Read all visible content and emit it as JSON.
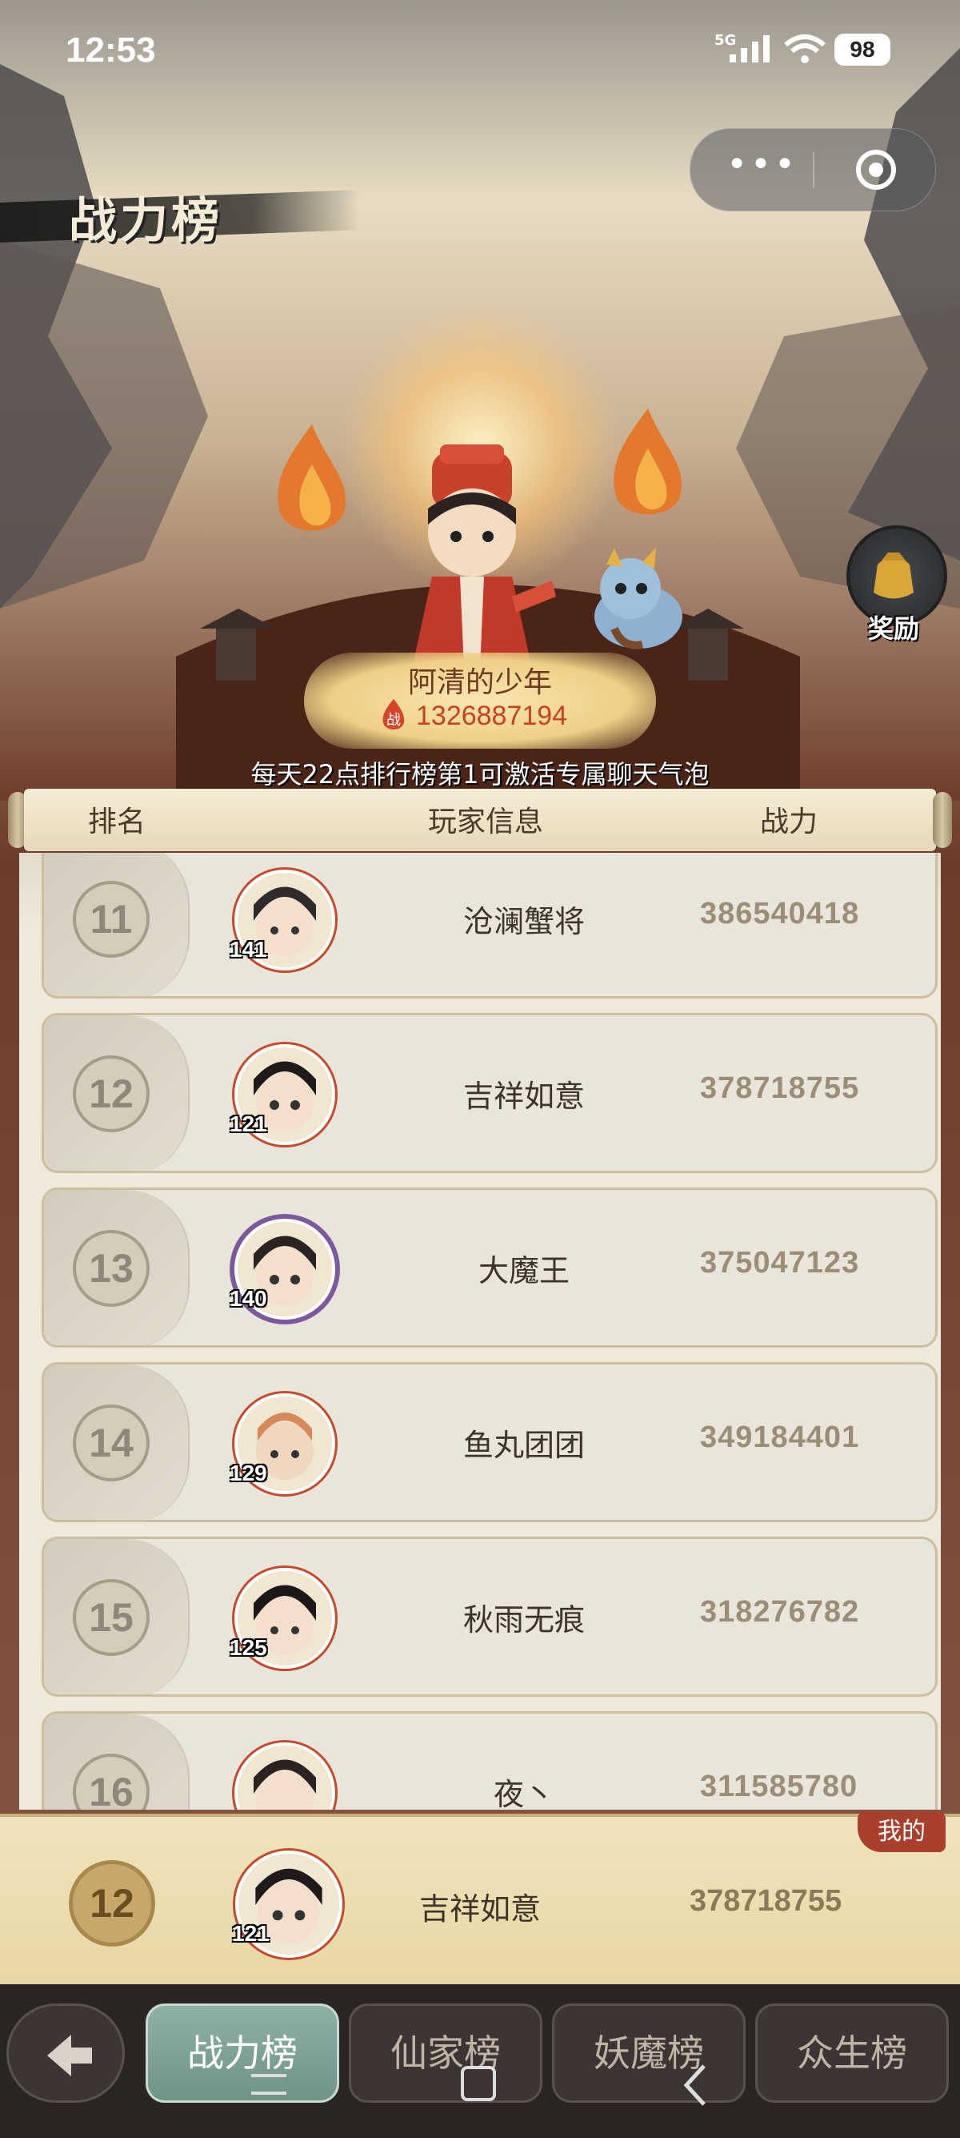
{
  "status_bar": {
    "time": "12:53",
    "network": "5G",
    "battery": "98"
  },
  "header": {
    "title": "战力榜",
    "menu_dots": "•••"
  },
  "reward": {
    "label": "奖励"
  },
  "top_player": {
    "name": "阿清的少年",
    "power": "1326887194",
    "power_icon": "战"
  },
  "banner": "每天22点排行榜第1可激活专属聊天气泡",
  "columns": {
    "rank": "排名",
    "player": "玩家信息",
    "power": "战力"
  },
  "rows": [
    {
      "rank": "11",
      "level": "141",
      "name": "沧澜蟹将",
      "power": "386540418"
    },
    {
      "rank": "12",
      "level": "121",
      "name": "吉祥如意",
      "power": "378718755"
    },
    {
      "rank": "13",
      "level": "140",
      "name": "大魔王",
      "power": "375047123"
    },
    {
      "rank": "14",
      "level": "129",
      "name": "鱼丸团团",
      "power": "349184401"
    },
    {
      "rank": "15",
      "level": "125",
      "name": "秋雨无痕",
      "power": "318276782"
    },
    {
      "rank": "16",
      "level": "",
      "name": "夜丶",
      "power": "311585780"
    }
  ],
  "mine": {
    "tag": "我的",
    "rank": "12",
    "level": "121",
    "name": "吉祥如意",
    "power": "378718755"
  },
  "tabs": [
    {
      "label": "战力榜",
      "active": true
    },
    {
      "label": "仙家榜",
      "active": false
    },
    {
      "label": "妖魔榜",
      "active": false
    },
    {
      "label": "众生榜",
      "active": false
    }
  ],
  "colors": {
    "accent_red": "#a93f2c",
    "active_tab": "#7ea096",
    "gold": "#c7a86a"
  }
}
